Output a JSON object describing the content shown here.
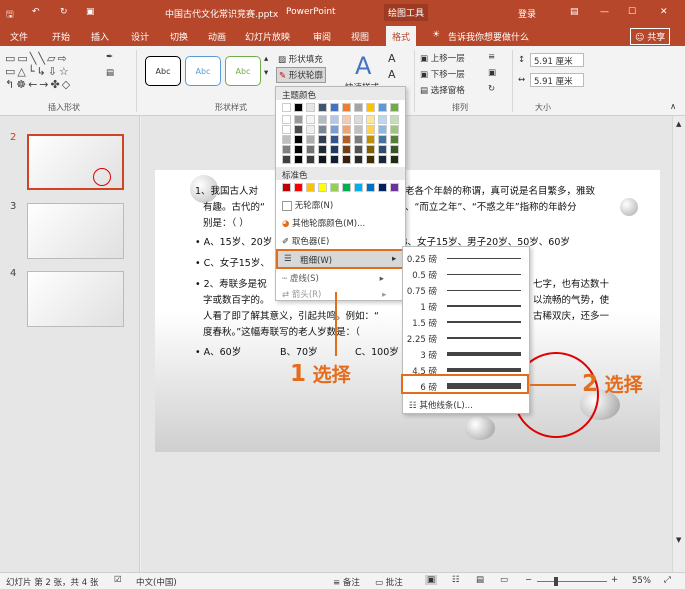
{
  "titlebar": {
    "file": "中国古代文化常识竞赛.pptx",
    "app": "PowerPoint",
    "context_tab": "绘图工具",
    "login": "登录",
    "min": "—",
    "max": "☐",
    "close": "✕"
  },
  "tabs": [
    "文件",
    "开始",
    "插入",
    "设计",
    "切换",
    "动画",
    "幻灯片放映",
    "审阅",
    "视图",
    "格式"
  ],
  "tellme": "告诉我你想要做什么",
  "share": "共享",
  "ribbon": {
    "insert_shapes_label": "插入形状",
    "shape_styles_label": "形状样式",
    "arrange_label": "排列",
    "size_label": "大小",
    "style_sample": "Abc",
    "fill": "形状填充",
    "outline": "形状轮廓",
    "quick_styles": "快速样式",
    "bring_forward": "上移一层",
    "send_backward": "下移一层",
    "selection_pane": "选择窗格",
    "height": "5.91 厘米",
    "width": "5.91 厘米"
  },
  "menu": {
    "theme_colors": "主题颜色",
    "standard_colors": "标准色",
    "no_outline": "无轮廓(N)",
    "more_colors": "其他轮廓颜色(M)...",
    "eyedropper": "取色器(E)",
    "weight": "粗细(W)",
    "dashes": "虚线(S)",
    "arrows": "箭头(R)"
  },
  "theme_colors": [
    "#ffffff",
    "#000000",
    "#e7e6e6",
    "#44546a",
    "#4472c4",
    "#ed7d31",
    "#a5a5a5",
    "#ffc000",
    "#5b9bd5",
    "#70ad47"
  ],
  "standard_colors": [
    "#c00000",
    "#ff0000",
    "#ffc000",
    "#ffff00",
    "#92d050",
    "#00b050",
    "#00b0f0",
    "#0070c0",
    "#002060",
    "#7030a0"
  ],
  "weights": [
    {
      "label": "0.25 磅",
      "pt": 0.25
    },
    {
      "label": "0.5 磅",
      "pt": 0.5
    },
    {
      "label": "0.75 磅",
      "pt": 0.75
    },
    {
      "label": "1 磅",
      "pt": 1
    },
    {
      "label": "1.5 磅",
      "pt": 1.5
    },
    {
      "label": "2.25 磅",
      "pt": 2.25
    },
    {
      "label": "3 磅",
      "pt": 3
    },
    {
      "label": "4.5 磅",
      "pt": 4.5
    },
    {
      "label": "6 磅",
      "pt": 6
    }
  ],
  "more_lines": "其他线条(L)...",
  "thumbs": [
    "2",
    "3",
    "4"
  ],
  "slide": {
    "l1a": "1、我国古人对",
    "l1b": "老各个年龄的称谓，真可说是名目繁多，雅致",
    "l2a": "有趣。古代的“",
    "l2b": "、“而立之年”、“不惑之年”指称的年龄分",
    "l3": "别是：（   ）",
    "l4a": "•  A、15岁、20岁",
    "l4b": "B、女子15岁、男子20岁、50岁、60岁",
    "l5a": "•  C、女子15岁、",
    "l6a": "•  2、寿联多是祝",
    "l6b": "七字，也有达数十",
    "l7a": "字或数百字的。",
    "l7b": "以流畅的气势，使",
    "l8": "人看了即了解其意义，引起共鸣。例如：“",
    "l8b": "古稀双庆，还多一",
    "l9": "度春秋。”这幅寿联写的老人岁数是：（",
    "l10a": "•  A、60岁",
    "l10b": "B、70岁",
    "l10c": "C、100岁"
  },
  "callouts": {
    "c1_num": "1",
    "c1_text": "选择",
    "c2_num": "2",
    "c2_text": "选择"
  },
  "status": {
    "slide": "幻灯片 第 2 张，共 4 张",
    "lang": "中文(中国)",
    "notes": "备注",
    "comments": "批注",
    "zoom": "55%"
  }
}
